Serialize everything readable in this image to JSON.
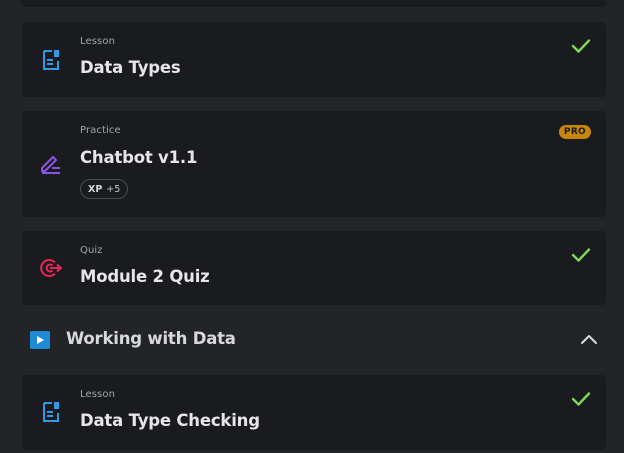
{
  "colors": {
    "background": "#232427",
    "card": "#1a1b1e",
    "lesson_icon": "#2f9be8",
    "practice_icon": "#8b55e6",
    "quiz_icon": "#e8265a",
    "check": "#7ed957",
    "pro_badge": "#c8860d",
    "section_icon": "#1f8ad4"
  },
  "items": [
    {
      "type": "Lesson",
      "title": "Data Types",
      "icon": "lesson-document-icon",
      "completed": true
    },
    {
      "type": "Practice",
      "title": "Chatbot v1.1",
      "icon": "pencil-edit-icon",
      "badge": "PRO",
      "xp_label": "XP",
      "xp_value": "+5"
    },
    {
      "type": "Quiz",
      "title": "Module 2 Quiz",
      "icon": "target-icon",
      "completed": true
    }
  ],
  "section": {
    "title": "Working with Data",
    "icon": "play-icon",
    "expanded": true,
    "toggle_icon": "chevron-up-icon",
    "items": [
      {
        "type": "Lesson",
        "title": "Data Type Checking",
        "icon": "lesson-document-icon",
        "completed": true
      }
    ]
  }
}
